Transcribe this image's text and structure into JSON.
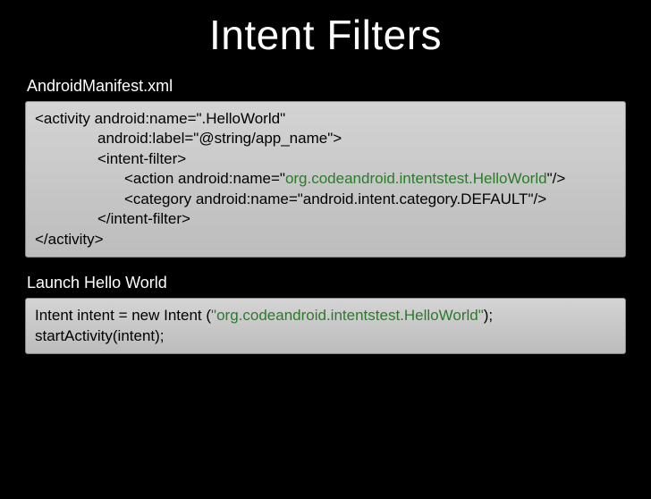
{
  "title": "Intent Filters",
  "section1": {
    "label": "AndroidManifest.xml",
    "code": {
      "l1": "<activity android:name=\".HelloWorld\"",
      "l2": "android:label=\"@string/app_name\">",
      "l3": "<intent-filter>",
      "l4a": "<action android:name=\"",
      "l4g": "org.codeandroid.intentstest.HelloWorld",
      "l4b": "\"/>",
      "l5": "<category android:name=\"android.intent.category.DEFAULT\"/>",
      "l6": "</intent-filter>",
      "l7": "</activity>"
    }
  },
  "section2": {
    "label": "Launch Hello World",
    "code": {
      "l1a": "Intent intent = new Intent (",
      "l1g": "\"org.codeandroid.intentstest.HelloWorld\"",
      "l1b": ");",
      "l2": "startActivity(intent);"
    }
  }
}
